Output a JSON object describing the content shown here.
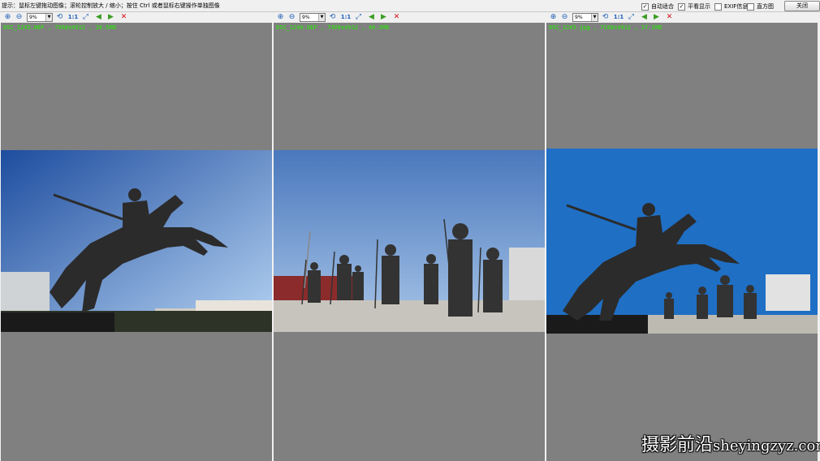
{
  "hint": "提示：鼠标左键拖动图像；滚轮控制放大 / 缩小；按住 Ctrl 或者鼠标右键操作单独图像",
  "options": [
    {
      "label": "自动适合",
      "checked": true
    },
    {
      "label": "平看显示",
      "checked": true
    },
    {
      "label": "EXIF信息",
      "checked": false
    },
    {
      "label": "直方图",
      "checked": false
    }
  ],
  "close_label": "关闭",
  "panes": [
    {
      "zoom": "9%",
      "fit_label": "1:1",
      "file_info": "DSC_1243.NEF , 7360x4912 , 39.5MB"
    },
    {
      "zoom": "9%",
      "fit_label": "1:1",
      "file_info": "DSC_1246.NEF , 7360x4912 , 40.3MB"
    },
    {
      "zoom": "9%",
      "fit_label": "1:1",
      "file_info": "DSC_1243.jpg , 7168x4912 , 17.2MB"
    }
  ],
  "icons": {
    "zoom_in": "zoom-in-icon",
    "zoom_out": "zoom-out-icon",
    "rotate": "rotate-icon",
    "fit": "fit-screen-icon",
    "prev": "previous-icon",
    "next": "next-icon",
    "close": "close-icon"
  },
  "watermark": {
    "cn": "摄影前沿",
    "en": "sheyingzyz.com"
  }
}
